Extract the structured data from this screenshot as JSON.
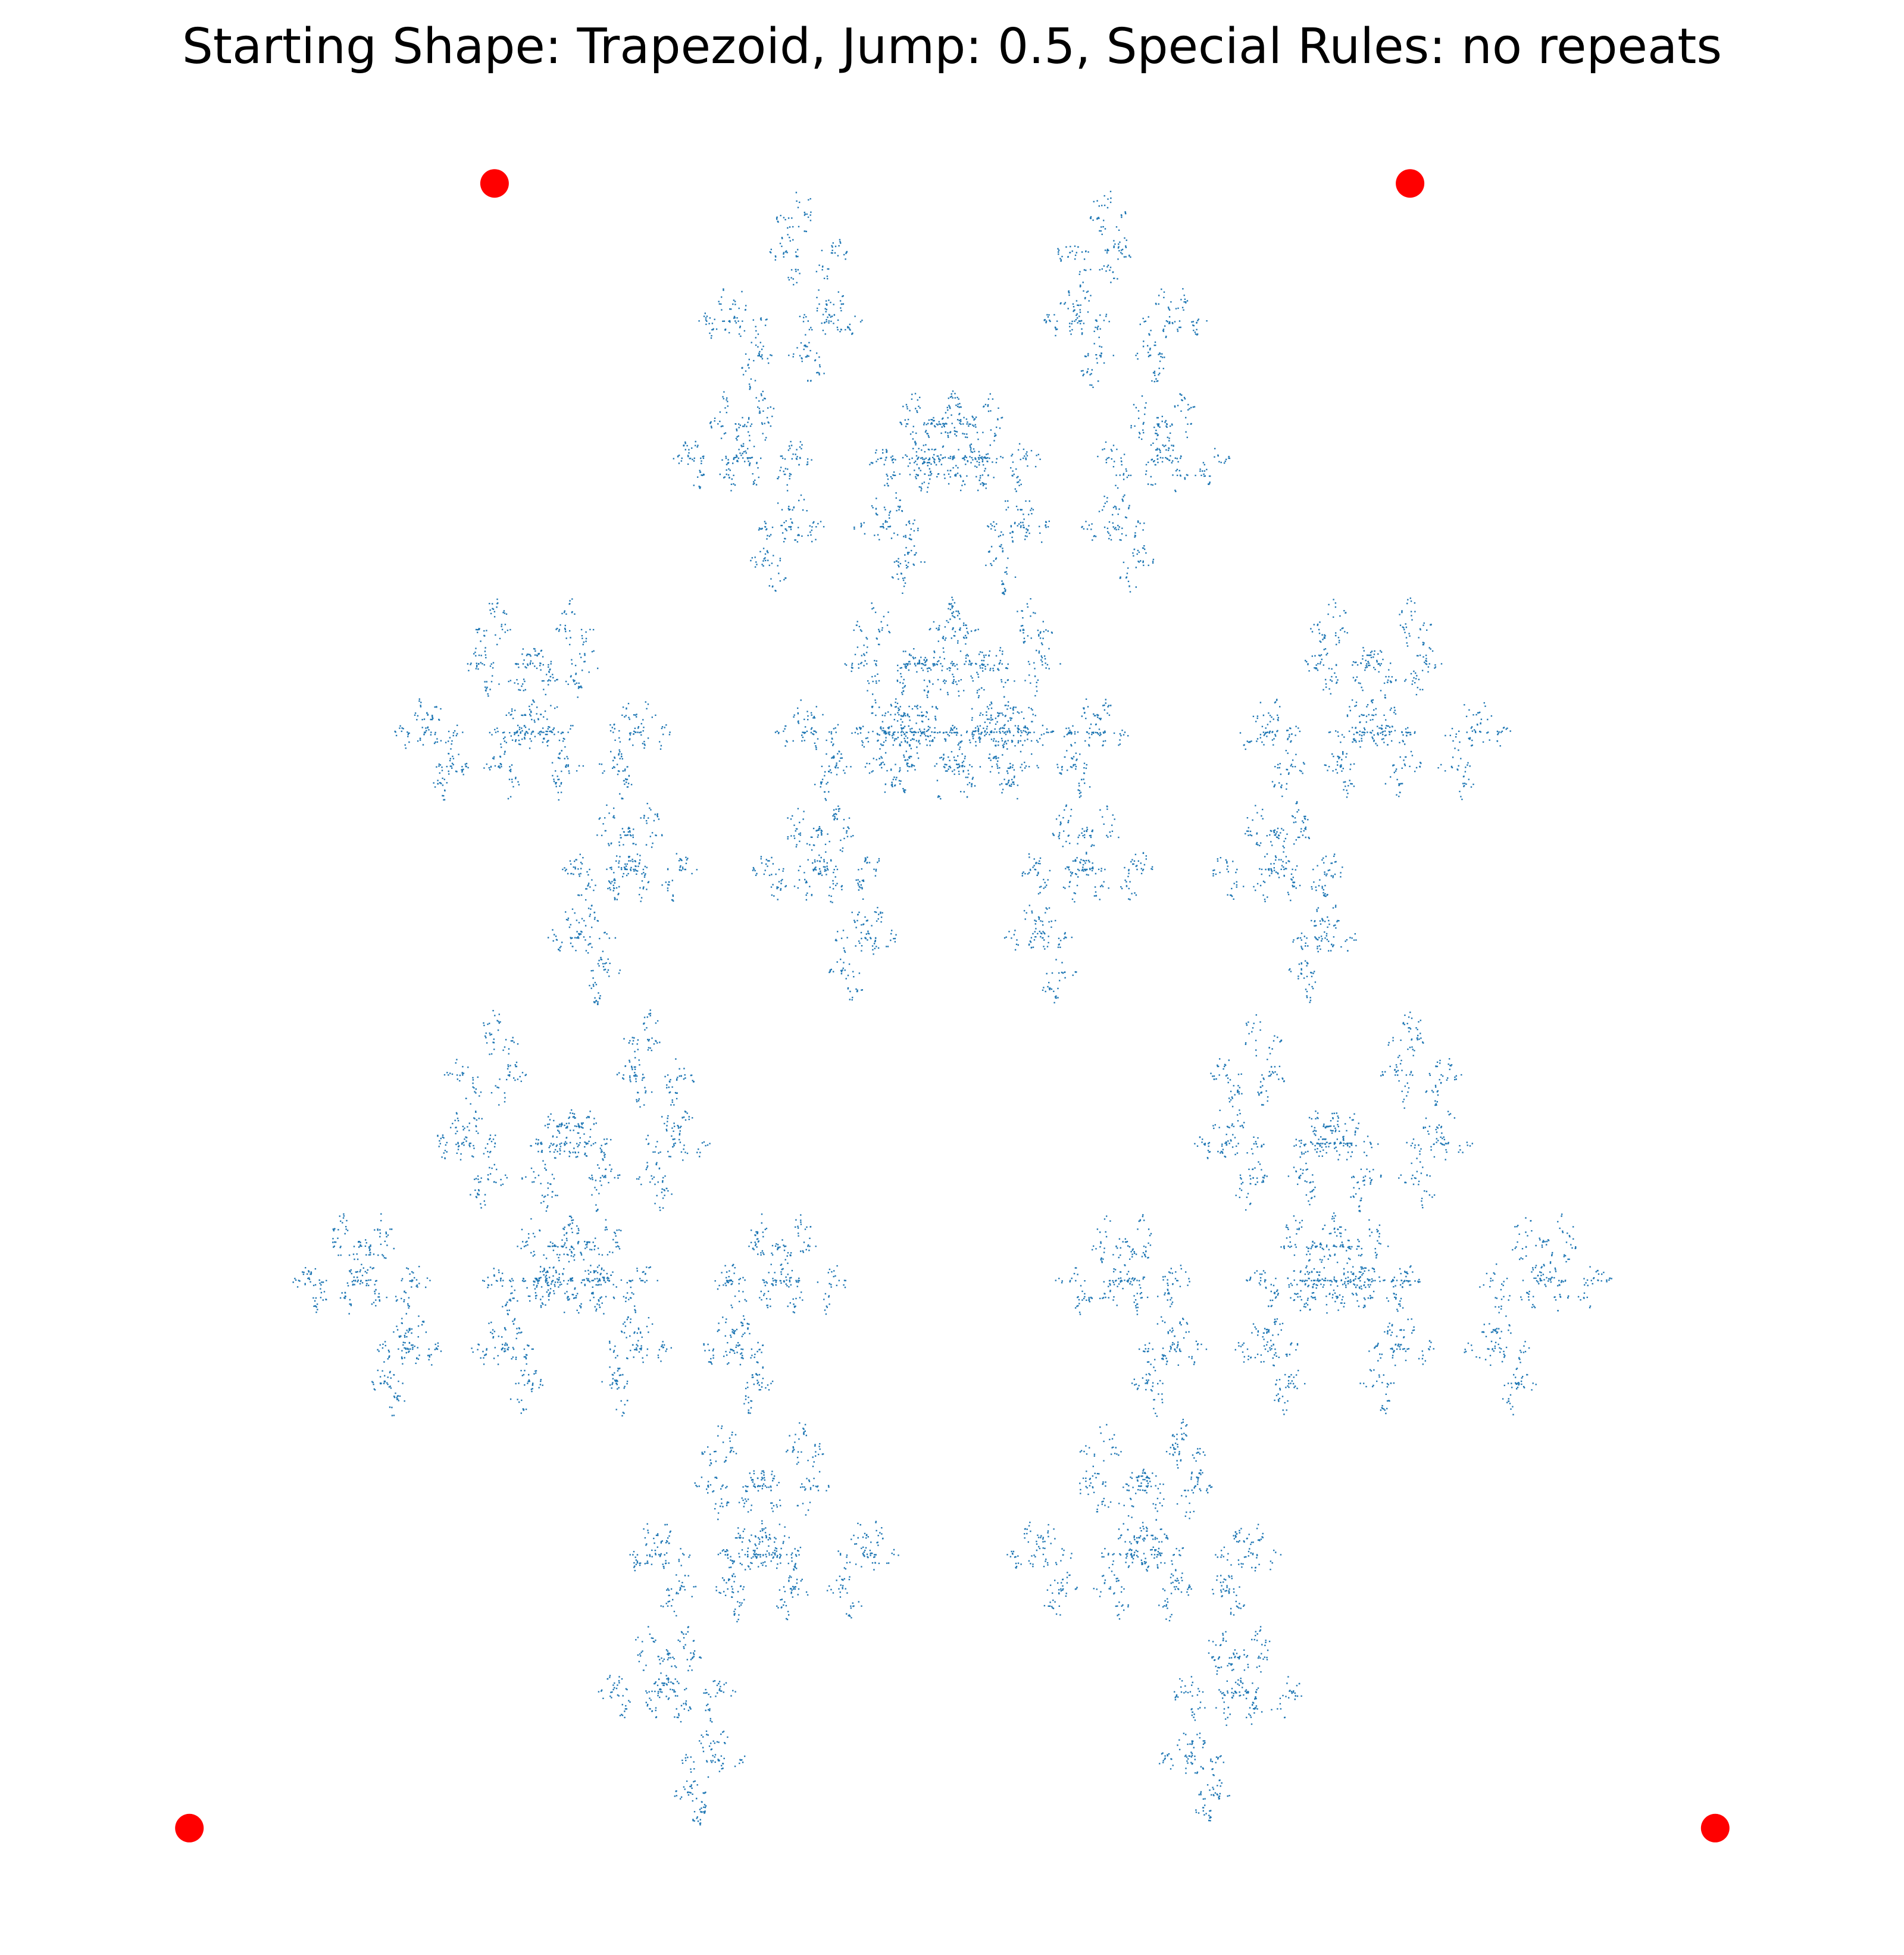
{
  "chart_data": {
    "type": "scatter",
    "title": "Starting Shape: Trapezoid, Jump: 0.5, Special Rules: no repeats",
    "shape": "Trapezoid",
    "jump": 0.5,
    "rule": "no repeats",
    "axes_visible": false,
    "grid": false,
    "xlim": [
      -0.05,
      1.05
    ],
    "ylim": [
      -0.05,
      1.05
    ],
    "vertices": {
      "x": [
        0,
        1,
        0.8,
        0.2
      ],
      "y": [
        0,
        0,
        1,
        1
      ]
    },
    "colors": {
      "vertex": "#ff0000",
      "points": "#1f77b4",
      "text": "#000000",
      "background": "#ffffff"
    }
  }
}
